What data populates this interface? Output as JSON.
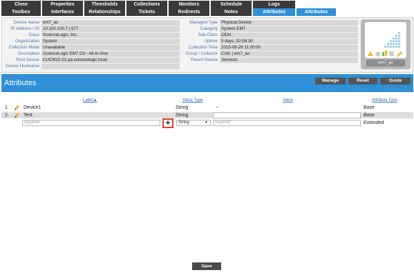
{
  "tabs_row1": [
    "Close",
    "Properties",
    "Thresholds",
    "Collections",
    "Monitors",
    "Schedule",
    "Logs"
  ],
  "tabs_row2": [
    "Toolbox",
    "Interfaces",
    "Relationships",
    "Tickets",
    "Redirects",
    "Notes",
    "Attributes",
    "Attributes"
  ],
  "device": {
    "left": [
      {
        "label": "Device Name",
        "value": "em7_ao"
      },
      {
        "label": "IP Address / ID",
        "value": "10.100.100.7 | 677"
      },
      {
        "label": "Class",
        "value": "ScienceLogic, Inc."
      },
      {
        "label": "Organization",
        "value": "System"
      },
      {
        "label": "Collection Mode",
        "value": "Unavailable"
      },
      {
        "label": "Description",
        "value": "ScienceLogic EM7 G3 - All-In-One"
      },
      {
        "label": "Root Device",
        "value": "CUCM10-01.qa.sciencelogic.local"
      },
      {
        "label": "Device Hostname",
        "value": ""
      }
    ],
    "right": [
      {
        "label": "Managed Type",
        "value": "Physical Device"
      },
      {
        "label": "Category",
        "value": "System.EM7"
      },
      {
        "label": "Sub-Class",
        "value": "OEM"
      },
      {
        "label": "Uptime",
        "value": "5 days, 02:06:30"
      },
      {
        "label": "Collection Time",
        "value": "2015-08-26 11:00:00"
      },
      {
        "label": "Group / Collector",
        "value": "CUG | em7_ao"
      },
      {
        "label": "Parent Device",
        "value": "Services"
      }
    ],
    "thumb_name": "em7_ao"
  },
  "attributes": {
    "title": "Attributes",
    "buttons": {
      "manage": "Manage",
      "reset": "Reset",
      "guide": "Guide"
    },
    "headers": {
      "label": "Label▲",
      "value_type": "Value Type",
      "value": "Value",
      "attribute_type": "Attribute Type"
    },
    "rows": [
      {
        "index": "1.",
        "label": "Device1",
        "value_type": "String",
        "value": "--",
        "attribute_type": "Base"
      },
      {
        "index": "2.",
        "label": "Test",
        "value_type": "String",
        "value": "",
        "attribute_type": "Base"
      }
    ],
    "new_row": {
      "label_placeholder": "required",
      "value_type": "String",
      "value_placeholder": "required",
      "attribute_type": "Extended"
    }
  },
  "save_label": "Save",
  "colors": {
    "accent": "#2f8fd7",
    "dark_tab": "#3a3a3a",
    "highlight": "#e53935"
  }
}
